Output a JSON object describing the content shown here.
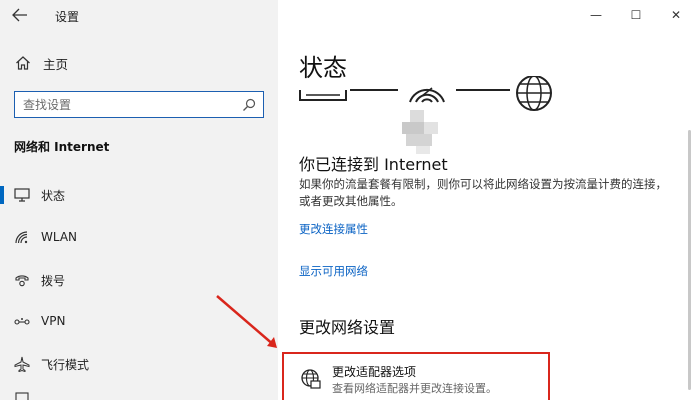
{
  "window": {
    "title": "设置",
    "controls": {
      "minimize": "—",
      "maximize": "☐",
      "close": "✕"
    }
  },
  "sidebar": {
    "home_label": "主页",
    "search_placeholder": "查找设置",
    "section_title": "网络和 Internet",
    "items": [
      {
        "label": "状态",
        "icon": "status-icon",
        "selected": true
      },
      {
        "label": "WLAN",
        "icon": "wifi-icon",
        "selected": false
      },
      {
        "label": "拨号",
        "icon": "dialup-icon",
        "selected": false
      },
      {
        "label": "VPN",
        "icon": "vpn-icon",
        "selected": false
      },
      {
        "label": "飞行模式",
        "icon": "airplane-icon",
        "selected": false
      }
    ]
  },
  "main": {
    "page_title": "状态",
    "connected_heading": "你已连接到 Internet",
    "connected_desc": "如果你的流量套餐有限制，则你可以将此网络设置为按流量计费的连接，或者更改其他属性。",
    "links": {
      "change_connection_properties": "更改连接属性",
      "show_available_networks": "显示可用网络"
    },
    "change_settings_heading": "更改网络设置",
    "adapter_option": {
      "title": "更改适配器选项",
      "subtitle": "查看网络适配器并更改连接设置。"
    }
  },
  "colors": {
    "accent": "#0067c0",
    "link": "#0b63c4",
    "highlight": "#d9261c",
    "sidebar_bg": "#f2f2f2"
  }
}
